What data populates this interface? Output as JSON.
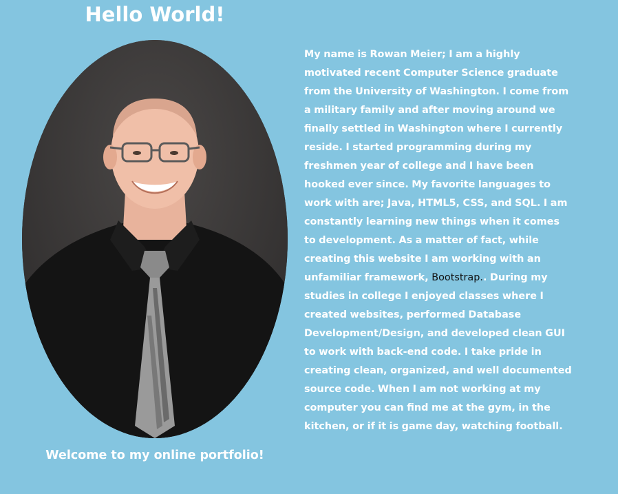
{
  "header": {
    "title": "Hello World!"
  },
  "profile": {
    "photo_icon": "profile-photo",
    "caption": "Welcome to my online portfolio!"
  },
  "bio": {
    "text_before_link": "My name is Rowan Meier; I am a highly motivated recent Computer Science graduate from the University of Washington. I come from a military family and after moving around we finally settled in Washington where I currently reside. I started programming during my freshmen year of college and I have been hooked ever since. My favorite languages to work with are; Java, HTML5, CSS, and SQL. I am constantly learning new things when it comes to development. As a matter of fact, while creating this website I am working with an unfamiliar framework, ",
    "link_text": "Bootstrap.",
    "text_after_link": ". During my studies in college I enjoyed classes where I created websites, performed Database Development/Design, and developed clean GUI to work with back-end code. I take pride in creating clean, organized, and well documented source code. When I am not working at my computer you can find me at the gym, in the kitchen, or if it is game day, watching football."
  },
  "colors": {
    "background": "#84c5e0",
    "text": "#ffffff",
    "link": "#111111"
  }
}
